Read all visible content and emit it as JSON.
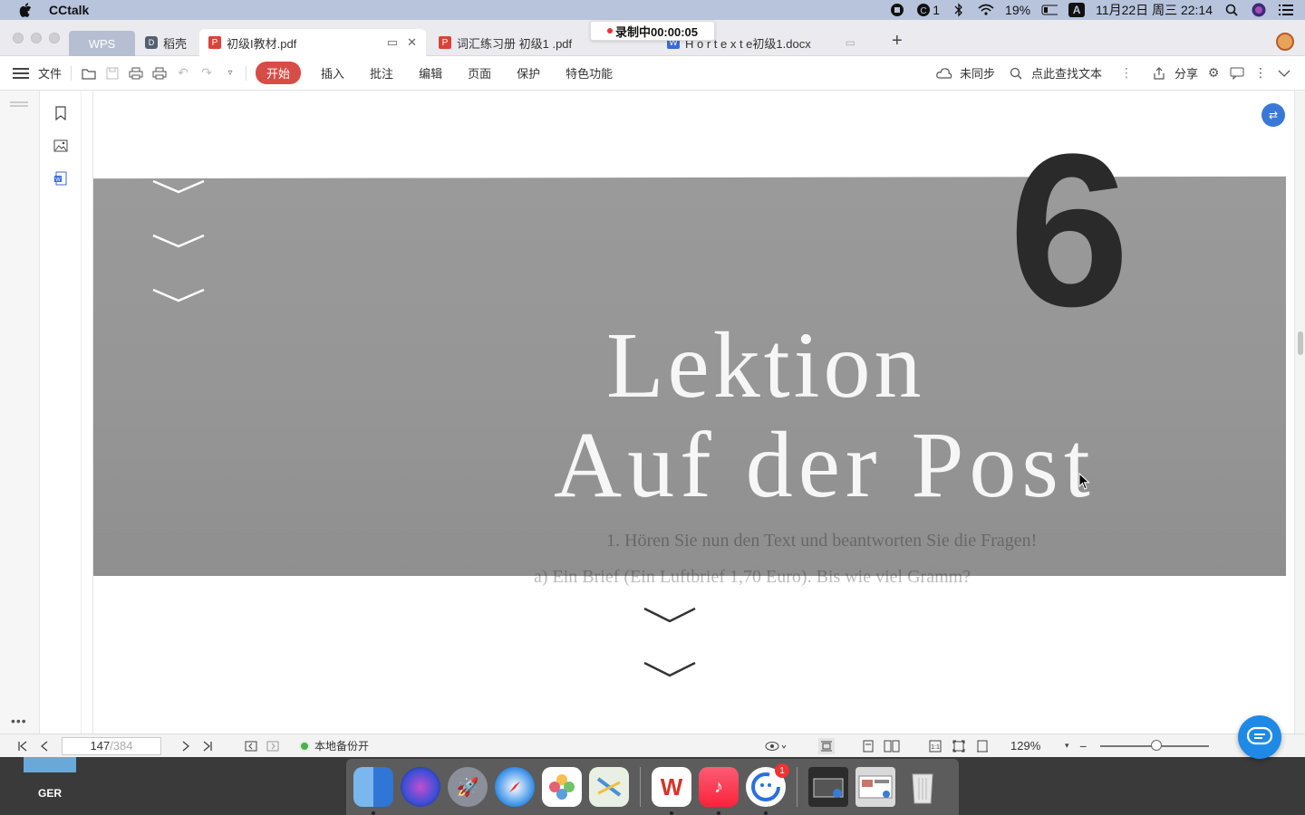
{
  "menubar": {
    "app_name": "CCtalk",
    "cctalk_count": "1",
    "battery": "19%",
    "input_method": "A",
    "datetime": "11月22日 周三  22:14"
  },
  "tabs": {
    "wps": "WPS",
    "daoke": "稻壳",
    "active_file": "初级I教材.pdf",
    "second_file": "词汇练习册 初级1 .pdf",
    "third_file": "H ö r t e x t e初级1.docx"
  },
  "recording": {
    "label": "录制中00:00:05"
  },
  "toolbar": {
    "file_label": "文件",
    "menus": [
      "开始",
      "插入",
      "批注",
      "编辑",
      "页面",
      "保护",
      "特色功能"
    ],
    "sync_label": "未同步",
    "search_label": "点此查找文本",
    "share_label": "分享"
  },
  "document": {
    "lesson_word": "Lektion",
    "lesson_number": "6",
    "lesson_subtitle": "Auf der Post",
    "ghost_line1": "1. Hören Sie nun den Text und beantworten Sie die Fragen!",
    "ghost_line2": "a) Ein Brief (Ein Luftbrief 1,70 Euro).  Bis wie viel Gramm?"
  },
  "statusbar": {
    "page_current": "147",
    "page_total": "/384",
    "backup_label": "本地备份开",
    "zoom": "129%"
  },
  "desktop": {
    "keyboard_label": "GER"
  },
  "dock": {
    "cctalk_badge": "1"
  },
  "colors": {
    "accent_red": "#d84c47",
    "wps_tab": "#b6bfd1",
    "banner_gray": "#959595",
    "menubar": "#b7c4dc"
  }
}
